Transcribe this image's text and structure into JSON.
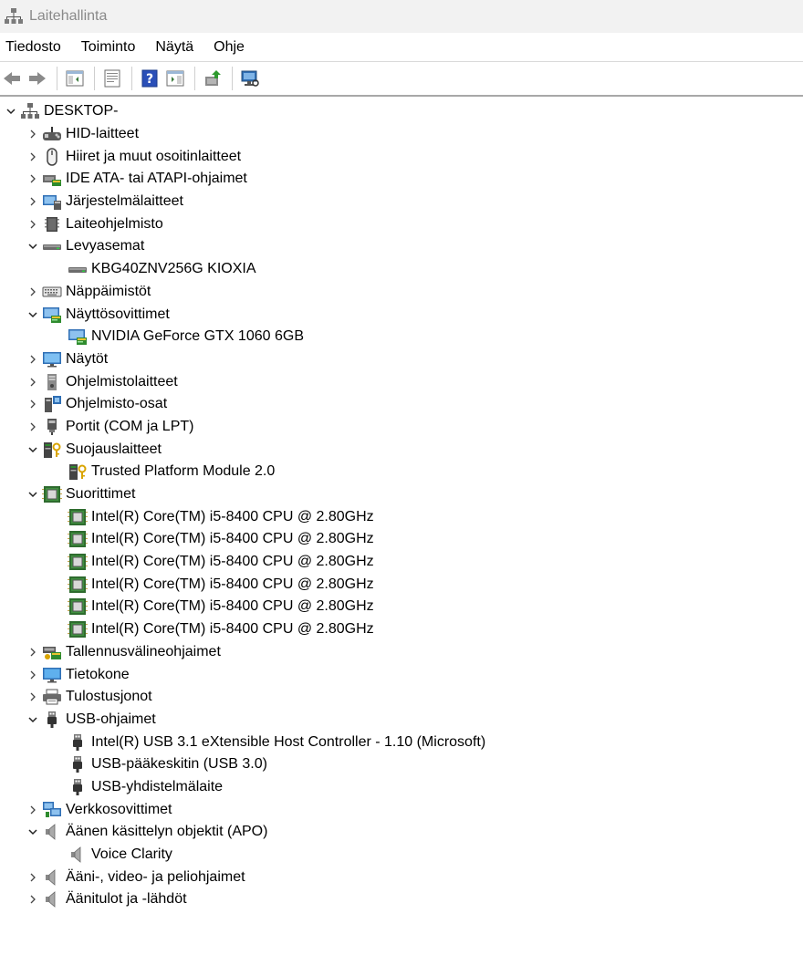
{
  "window": {
    "title": "Laitehallinta"
  },
  "menu": [
    "Tiedosto",
    "Toiminto",
    "Näytä",
    "Ohje"
  ],
  "toolbar": [
    {
      "name": "back-arrow-icon"
    },
    {
      "name": "forward-arrow-icon"
    },
    {
      "sep": true
    },
    {
      "name": "show-hide-console-tree-icon"
    },
    {
      "sep": true
    },
    {
      "name": "properties-icon"
    },
    {
      "sep": true
    },
    {
      "name": "help-icon"
    },
    {
      "name": "show-action-pane-icon"
    },
    {
      "sep": true
    },
    {
      "name": "update-driver-icon"
    },
    {
      "sep": true
    },
    {
      "name": "scan-hardware-icon"
    }
  ],
  "tree": [
    {
      "level": 0,
      "label": "DESKTOP-",
      "expanded": true,
      "icon": "computer-network-icon"
    },
    {
      "level": 1,
      "label": "HID-laitteet",
      "expanded": false,
      "icon": "hid-icon"
    },
    {
      "level": 1,
      "label": "Hiiret ja muut osoitinlaitteet",
      "expanded": false,
      "icon": "mouse-icon"
    },
    {
      "level": 1,
      "label": "IDE ATA- tai ATAPI-ohjaimet",
      "expanded": false,
      "icon": "ide-controller-icon"
    },
    {
      "level": 1,
      "label": "Järjestelmälaitteet",
      "expanded": false,
      "icon": "system-device-icon"
    },
    {
      "level": 1,
      "label": "Laiteohjelmisto",
      "expanded": false,
      "icon": "firmware-icon"
    },
    {
      "level": 1,
      "label": "Levyasemat",
      "expanded": true,
      "icon": "disk-drive-icon"
    },
    {
      "level": 2,
      "label": "KBG40ZNV256G KIOXIA",
      "icon": "disk-drive-icon"
    },
    {
      "level": 1,
      "label": "Näppäimistöt",
      "expanded": false,
      "icon": "keyboard-icon"
    },
    {
      "level": 1,
      "label": "Näyttösovittimet",
      "expanded": true,
      "icon": "display-adapter-icon"
    },
    {
      "level": 2,
      "label": "NVIDIA GeForce GTX 1060 6GB",
      "icon": "display-adapter-icon"
    },
    {
      "level": 1,
      "label": "Näytöt",
      "expanded": false,
      "icon": "monitor-icon"
    },
    {
      "level": 1,
      "label": "Ohjelmistolaitteet",
      "expanded": false,
      "icon": "software-device-icon"
    },
    {
      "level": 1,
      "label": "Ohjelmisto-osat",
      "expanded": false,
      "icon": "software-component-icon"
    },
    {
      "level": 1,
      "label": "Portit (COM ja LPT)",
      "expanded": false,
      "icon": "port-icon"
    },
    {
      "level": 1,
      "label": "Suojauslaitteet",
      "expanded": true,
      "icon": "security-device-icon"
    },
    {
      "level": 2,
      "label": "Trusted Platform Module 2.0",
      "icon": "security-device-icon"
    },
    {
      "level": 1,
      "label": "Suorittimet",
      "expanded": true,
      "icon": "processor-icon"
    },
    {
      "level": 2,
      "label": "Intel(R) Core(TM) i5-8400 CPU @ 2.80GHz",
      "icon": "processor-icon"
    },
    {
      "level": 2,
      "label": "Intel(R) Core(TM) i5-8400 CPU @ 2.80GHz",
      "icon": "processor-icon"
    },
    {
      "level": 2,
      "label": "Intel(R) Core(TM) i5-8400 CPU @ 2.80GHz",
      "icon": "processor-icon"
    },
    {
      "level": 2,
      "label": "Intel(R) Core(TM) i5-8400 CPU @ 2.80GHz",
      "icon": "processor-icon"
    },
    {
      "level": 2,
      "label": "Intel(R) Core(TM) i5-8400 CPU @ 2.80GHz",
      "icon": "processor-icon"
    },
    {
      "level": 2,
      "label": "Intel(R) Core(TM) i5-8400 CPU @ 2.80GHz",
      "icon": "processor-icon"
    },
    {
      "level": 1,
      "label": "Tallennusvälineohjaimet",
      "expanded": false,
      "icon": "storage-controller-icon"
    },
    {
      "level": 1,
      "label": "Tietokone",
      "expanded": false,
      "icon": "computer-icon"
    },
    {
      "level": 1,
      "label": "Tulostusjonot",
      "expanded": false,
      "icon": "printer-icon"
    },
    {
      "level": 1,
      "label": "USB-ohjaimet",
      "expanded": true,
      "icon": "usb-icon"
    },
    {
      "level": 2,
      "label": "Intel(R) USB 3.1 eXtensible Host Controller - 1.10 (Microsoft)",
      "icon": "usb-icon"
    },
    {
      "level": 2,
      "label": "USB-pääkeskitin (USB 3.0)",
      "icon": "usb-icon"
    },
    {
      "level": 2,
      "label": "USB-yhdistelmälaite",
      "icon": "usb-icon"
    },
    {
      "level": 1,
      "label": "Verkkosovittimet",
      "expanded": false,
      "icon": "network-adapter-icon"
    },
    {
      "level": 1,
      "label": "Äänen käsittelyn objektit (APO)",
      "expanded": true,
      "icon": "speaker-icon"
    },
    {
      "level": 2,
      "label": "Voice Clarity",
      "icon": "speaker-icon"
    },
    {
      "level": 1,
      "label": "Ääni-, video- ja peliohjaimet",
      "expanded": false,
      "icon": "speaker-icon"
    },
    {
      "level": 1,
      "label": "Äänitulot ja -lähdöt",
      "expanded": false,
      "icon": "speaker-icon"
    }
  ]
}
